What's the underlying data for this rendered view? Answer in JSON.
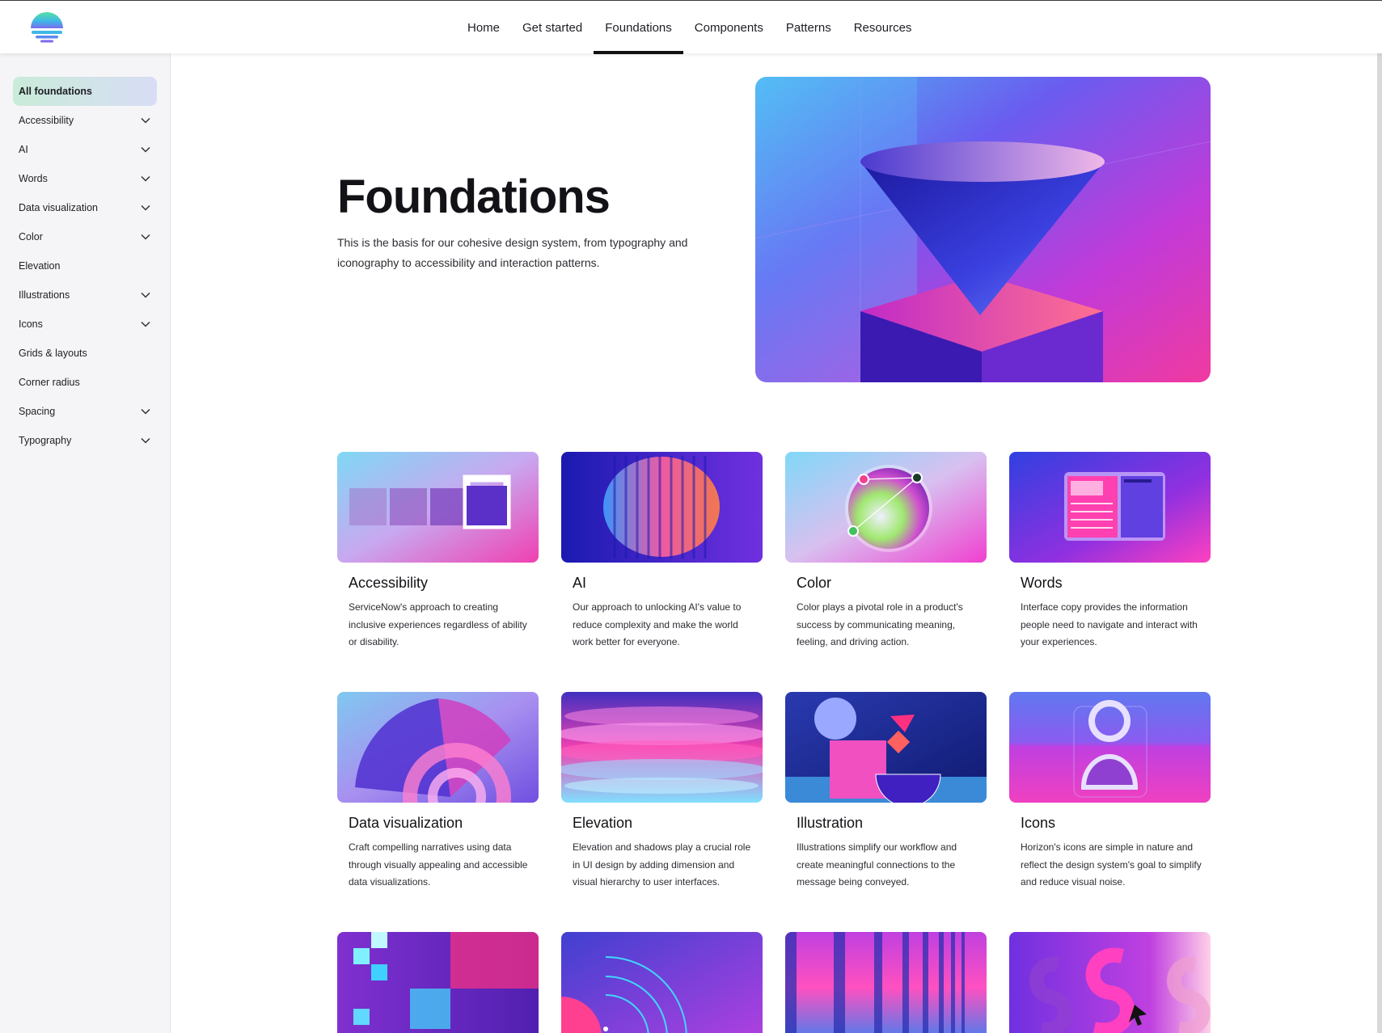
{
  "nav": {
    "items": [
      {
        "label": "Home",
        "active": false
      },
      {
        "label": "Get started",
        "active": false
      },
      {
        "label": "Foundations",
        "active": true
      },
      {
        "label": "Components",
        "active": false
      },
      {
        "label": "Patterns",
        "active": false
      },
      {
        "label": "Resources",
        "active": false
      }
    ]
  },
  "sidebar": {
    "items": [
      {
        "label": "All foundations",
        "active": true,
        "expandable": false
      },
      {
        "label": "Accessibility",
        "active": false,
        "expandable": true
      },
      {
        "label": "AI",
        "active": false,
        "expandable": true
      },
      {
        "label": "Words",
        "active": false,
        "expandable": true
      },
      {
        "label": "Data visualization",
        "active": false,
        "expandable": true
      },
      {
        "label": "Color",
        "active": false,
        "expandable": true
      },
      {
        "label": "Elevation",
        "active": false,
        "expandable": false
      },
      {
        "label": "Illustrations",
        "active": false,
        "expandable": true
      },
      {
        "label": "Icons",
        "active": false,
        "expandable": true
      },
      {
        "label": "Grids & layouts",
        "active": false,
        "expandable": false
      },
      {
        "label": "Corner radius",
        "active": false,
        "expandable": false
      },
      {
        "label": "Spacing",
        "active": false,
        "expandable": true
      },
      {
        "label": "Typography",
        "active": false,
        "expandable": true
      }
    ]
  },
  "hero": {
    "title": "Foundations",
    "description": "This is the basis for our cohesive design system, from typography and iconography to accessibility and interaction patterns."
  },
  "cards": [
    {
      "title": "Accessibility",
      "description": "ServiceNow's approach to creating inclusive experiences regardless of ability or disability."
    },
    {
      "title": "AI",
      "description": "Our approach to unlocking AI's value to reduce complexity and make the world work better for everyone."
    },
    {
      "title": "Color",
      "description": "Color plays a pivotal role in a product's success by communicating meaning, feeling, and driving action."
    },
    {
      "title": "Words",
      "description": "Interface copy provides the information people need to navigate and interact with your experiences."
    },
    {
      "title": "Data visualization",
      "description": "Craft compelling narratives using data through visually appealing and accessible data visualizations."
    },
    {
      "title": "Elevation",
      "description": "Elevation and shadows play a crucial role in UI design by adding dimension and visual hierarchy to user interfaces."
    },
    {
      "title": "Illustration",
      "description": "Illustrations simplify our workflow and create meaningful connections to the message being conveyed."
    },
    {
      "title": "Icons",
      "description": "Horizon's icons are simple in nature and reflect the design system's goal to simplify and reduce visual noise."
    }
  ],
  "colors": {
    "accent": "#111111",
    "sidebar_bg": "#f5f5f7",
    "active_gradient_start": "#c9ecd9",
    "active_gradient_end": "#d8dcf5"
  }
}
